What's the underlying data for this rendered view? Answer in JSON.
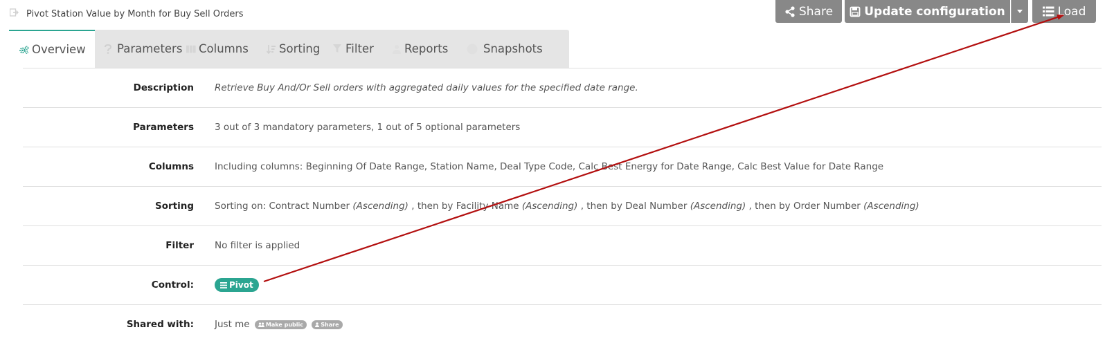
{
  "page": {
    "title": "Pivot Station Value by Month for Buy Sell Orders"
  },
  "toolbar": {
    "share_label": "Share",
    "update_label": "Update configuration",
    "load_label": "Load"
  },
  "tabs": [
    {
      "label": "Overview",
      "icon": "cogs-icon",
      "active": true
    },
    {
      "label": "Parameters",
      "icon": "question-icon"
    },
    {
      "label": "Columns",
      "icon": "columns-icon"
    },
    {
      "label": "Sorting",
      "icon": "sort-icon"
    },
    {
      "label": "Filter",
      "icon": "filter-icon"
    },
    {
      "label": "Reports",
      "icon": "reports-icon"
    },
    {
      "label": "Snapshots",
      "icon": "camera-icon"
    }
  ],
  "overview": {
    "description_label": "Description",
    "description_value": "Retrieve Buy And/Or Sell orders with aggregated daily values for the specified date range.",
    "parameters_label": "Parameters",
    "parameters_value": "3 out of 3 mandatory parameters, 1 out of 5 optional parameters",
    "columns_label": "Columns",
    "columns_value": "Including columns: Beginning Of Date Range, Station Name, Deal Type Code, Calc Best Energy for Date Range, Calc Best Value for Date Range",
    "sorting_label": "Sorting",
    "sorting": {
      "prefix": "Sorting on: ",
      "items": [
        {
          "field": "Contract Number",
          "dir": "(Ascending)"
        },
        {
          "field": "Facility Name",
          "dir": "(Ascending)"
        },
        {
          "field": "Deal Number",
          "dir": "(Ascending)"
        },
        {
          "field": "Order Number",
          "dir": "(Ascending)"
        }
      ],
      "then_by": " , then by "
    },
    "filter_label": "Filter",
    "filter_value": "No filter is applied",
    "control_label": "Control:",
    "control_value": "Pivot",
    "shared_label": "Shared with:",
    "shared_value": "Just me",
    "make_public_label": "Make public",
    "share_small_label": "Share"
  },
  "annotation": {
    "color": "#b30f0f"
  }
}
